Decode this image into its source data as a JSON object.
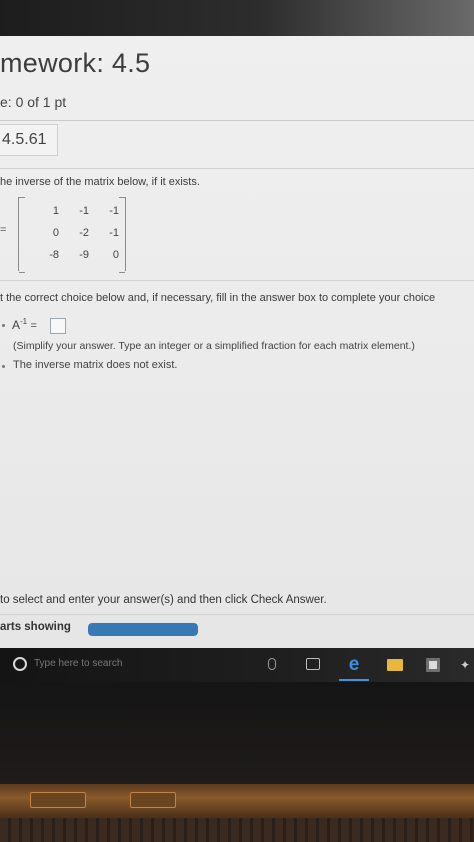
{
  "header": {
    "title": "mework: 4.5",
    "score": "e: 0 of 1 pt",
    "question_number": "4.5.61"
  },
  "question": {
    "instruction": "he inverse of the matrix below, if it exists.",
    "lhs": "=",
    "matrix": [
      [
        "1",
        "-1",
        "-1"
      ],
      [
        "0",
        "-2",
        "-1"
      ],
      [
        "-8",
        "-9",
        "0"
      ]
    ],
    "select_text": "t the correct choice below and, if necessary, fill in the answer box to complete your choice",
    "choice_a_label": "A",
    "choice_a_superscript": "-1",
    "choice_a_equals": "=",
    "hint": "(Simplify your answer. Type an integer or a simplified fraction for each matrix element.)",
    "choice_b": "The inverse matrix does not exist."
  },
  "footer": {
    "instruction": "to select and enter your answer(s) and then click Check Answer.",
    "parts_label": "arts showing",
    "progress": 1.0
  },
  "taskbar": {
    "search_placeholder": "Type here to search"
  },
  "icons": {
    "search": "search-circle-icon",
    "mic": "microphone-icon",
    "task_view": "task-view-icon",
    "edge": "edge-browser-icon",
    "file_explorer": "folder-icon",
    "store": "store-icon"
  },
  "colors": {
    "progress_fill": "#3779b5",
    "edge_blue": "#3b8fe0",
    "folder_yellow": "#e8b83a"
  }
}
